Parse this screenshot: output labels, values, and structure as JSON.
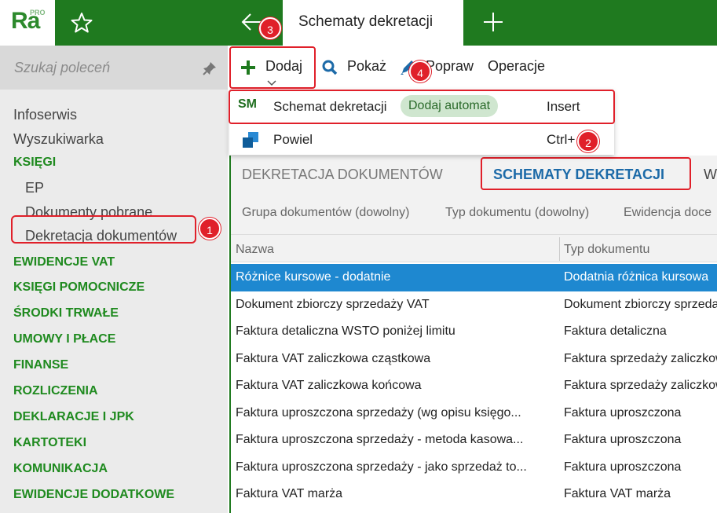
{
  "app": {
    "logo_text": "Ra",
    "logo_badge": "PRO",
    "active_tab": "Schematy dekretacji"
  },
  "colors": {
    "brand_green": "#1f7a1f",
    "selection_blue": "#1e88d0",
    "annotation_red": "#e0202a",
    "active_tab_blue": "#1c6aa8"
  },
  "sidebar": {
    "search_placeholder": "Szukaj poleceń",
    "items": [
      {
        "label": "Infoserwis",
        "kind": "item"
      },
      {
        "label": "Wyszukiwarka",
        "kind": "item"
      },
      {
        "label": "KSIĘGI",
        "kind": "group"
      },
      {
        "label": "EP",
        "kind": "sub"
      },
      {
        "label": "Dokumenty pobrane",
        "kind": "sub"
      },
      {
        "label": "Dekretacja dokumentów",
        "kind": "sub"
      },
      {
        "label": "EWIDENCJE VAT",
        "kind": "group"
      },
      {
        "label": "KSIĘGI POMOCNICZE",
        "kind": "group"
      },
      {
        "label": "ŚRODKI TRWAŁE",
        "kind": "group"
      },
      {
        "label": "UMOWY I PŁACE",
        "kind": "group"
      },
      {
        "label": "FINANSE",
        "kind": "group"
      },
      {
        "label": "ROZLICZENIA",
        "kind": "group"
      },
      {
        "label": "DEKLARACJE I JPK",
        "kind": "group"
      },
      {
        "label": "KARTOTEKI",
        "kind": "group"
      },
      {
        "label": "KOMUNIKACJA",
        "kind": "group"
      },
      {
        "label": "EWIDENCJE DODATKOWE",
        "kind": "group"
      }
    ]
  },
  "toolbar": {
    "add_label": "Dodaj",
    "show_label": "Pokaż",
    "edit_label": "Popraw",
    "operations_label": "Operacje"
  },
  "dropdown": {
    "items": [
      {
        "icon_text": "SM",
        "label": "Schemat dekretacji",
        "chip": "Dodaj automat",
        "shortcut": "Insert"
      },
      {
        "label": "Powiel",
        "shortcut": "Ctrl+"
      }
    ]
  },
  "main_tabs": [
    "DEKRETACJA DOKUMENTÓW",
    "SCHEMATY DEKRETACJI",
    "Wi"
  ],
  "filters": [
    "Grupa dokumentów (dowolny)",
    "Typ dokumentu (dowolny)",
    "Ewidencja doce"
  ],
  "table": {
    "columns": [
      "Nazwa",
      "Typ dokumentu"
    ],
    "rows": [
      {
        "name": "Różnice kursowe - dodatnie",
        "type": "Dodatnia różnica kursowa",
        "selected": true
      },
      {
        "name": "Dokument zbiorczy sprzedaży VAT",
        "type": "Dokument zbiorczy sprzedaży"
      },
      {
        "name": "Faktura detaliczna WSTO poniżej limitu",
        "type": "Faktura detaliczna"
      },
      {
        "name": "Faktura VAT zaliczkowa cząstkowa",
        "type": "Faktura sprzedaży zaliczkowa"
      },
      {
        "name": "Faktura VAT zaliczkowa końcowa",
        "type": "Faktura sprzedaży zaliczkowa"
      },
      {
        "name": "Faktura uproszczona sprzedaży (wg opisu księgo...",
        "type": "Faktura uproszczona"
      },
      {
        "name": "Faktura uproszczona sprzedaży - metoda kasowa...",
        "type": "Faktura uproszczona"
      },
      {
        "name": "Faktura uproszczona sprzedaży - jako sprzedaż to...",
        "type": "Faktura uproszczona"
      },
      {
        "name": "Faktura VAT marża",
        "type": "Faktura VAT marża"
      }
    ]
  },
  "annotations": [
    "1",
    "2",
    "3",
    "4"
  ]
}
